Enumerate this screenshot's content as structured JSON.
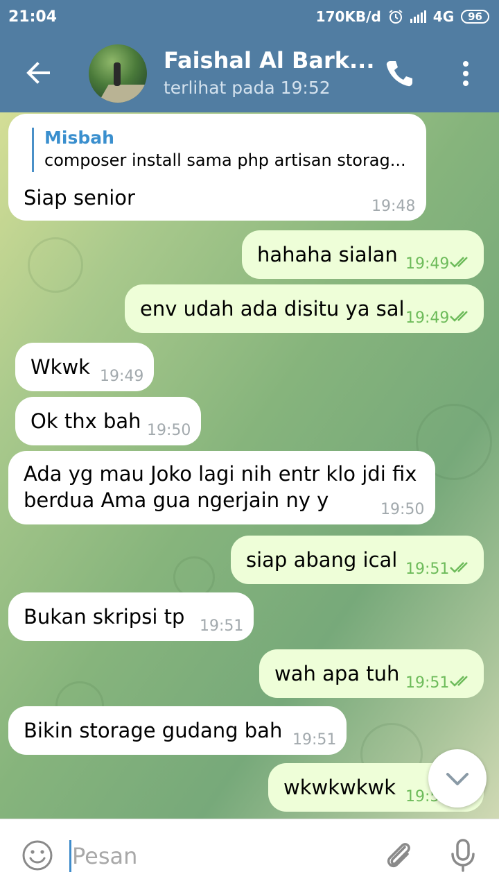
{
  "status_bar": {
    "time": "21:04",
    "network_speed": "170KB/d",
    "network_type": "4G",
    "battery": "96",
    "icons": [
      "alarm-icon",
      "signal-icon",
      "battery-icon"
    ]
  },
  "header": {
    "contact_name": "Faishal Al Bark...",
    "last_seen": "terlihat pada  19:52",
    "icons": [
      "back-arrow-icon",
      "phone-icon",
      "more-vert-icon"
    ],
    "color": "#517da2"
  },
  "messages": [
    {
      "direction": "in",
      "reply_to": {
        "name": "Misbah",
        "text": "composer install sama php artisan storag..."
      },
      "text": "Siap senior",
      "time": "19:48"
    },
    {
      "direction": "out",
      "text": "hahaha sialan",
      "time": "19:49",
      "read": true
    },
    {
      "direction": "out",
      "text": "env udah ada disitu ya sal",
      "time": "19:49",
      "read": true
    },
    {
      "direction": "in",
      "text": "Wkwk",
      "time": "19:49"
    },
    {
      "direction": "in",
      "text": "Ok thx bah",
      "time": "19:50"
    },
    {
      "direction": "in",
      "lines": [
        "Ada yg mau Joko lagi nih entr klo jdi fix",
        "berdua Ama gua ngerjain ny y"
      ],
      "time": "19:50"
    },
    {
      "direction": "out",
      "text": "siap abang ical",
      "time": "19:51",
      "read": true
    },
    {
      "direction": "in",
      "text": "Bukan skripsi tp",
      "time": "19:51"
    },
    {
      "direction": "out",
      "text": "wah apa tuh",
      "time": "19:51",
      "read": true
    },
    {
      "direction": "in",
      "text": "Bikin storage gudang bah",
      "time": "19:51"
    },
    {
      "direction": "out",
      "text": "wkwkwkwk",
      "time": "19:5",
      "read": true
    }
  ],
  "composer": {
    "placeholder": "Pesan",
    "icons": [
      "emoji-icon",
      "attach-icon",
      "mic-icon"
    ]
  },
  "colors": {
    "incoming_bubble": "#ffffff",
    "outgoing_bubble": "#eefed8",
    "outgoing_time": "#6dbb5a",
    "accent": "#3a8fce"
  }
}
